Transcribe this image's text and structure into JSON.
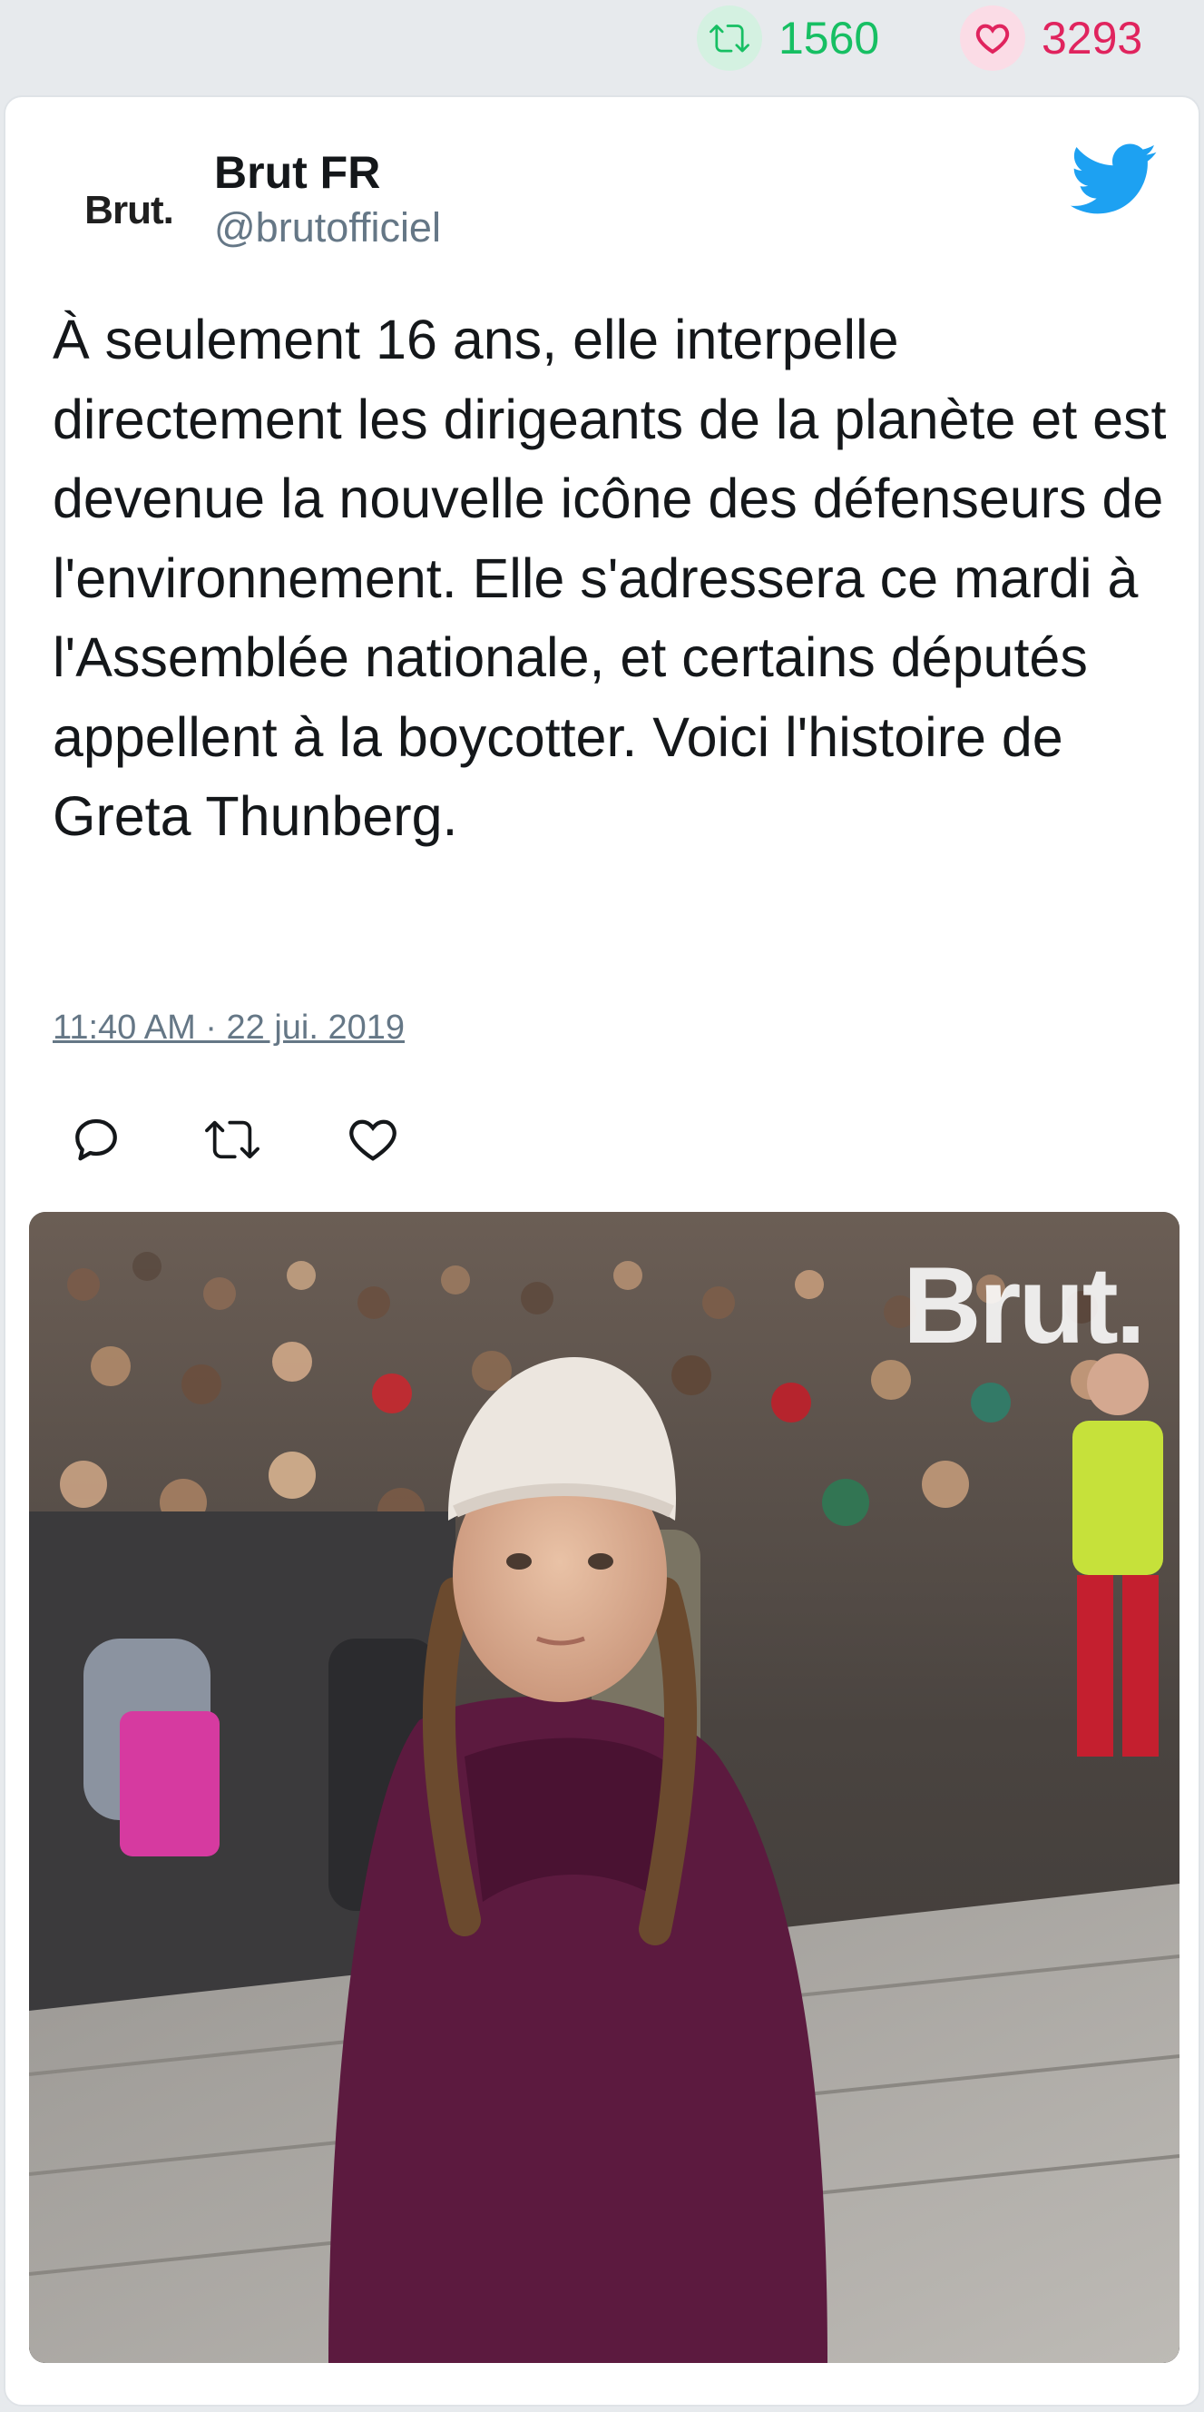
{
  "stats": {
    "retweets": "1560",
    "likes": "3293",
    "retweet_icon": "retweet-icon",
    "like_icon": "heart-icon",
    "retweet_color": "#17bf63",
    "like_color": "#e0245e"
  },
  "tweet": {
    "author_name": "Brut FR",
    "author_handle": "@brutofficiel",
    "avatar_logo": "Brut.",
    "platform_icon": "twitter-bird-icon",
    "text": "À seulement 16 ans, elle interpelle directement les dirigeants de la planète et est devenue la nouvelle icône des défenseurs de l'environnement. Elle s'adressera ce mardi à l'Assemblée nationale, et certains députés appellent à la boycotter. Voici l'histoire de Greta Thunberg.",
    "timestamp": "11:40 AM · 22 jui. 2019",
    "actions": [
      "reply-icon",
      "retweet-icon",
      "heart-icon"
    ],
    "accent_color": "#1da1f2"
  },
  "media": {
    "watermark": "Brut."
  }
}
